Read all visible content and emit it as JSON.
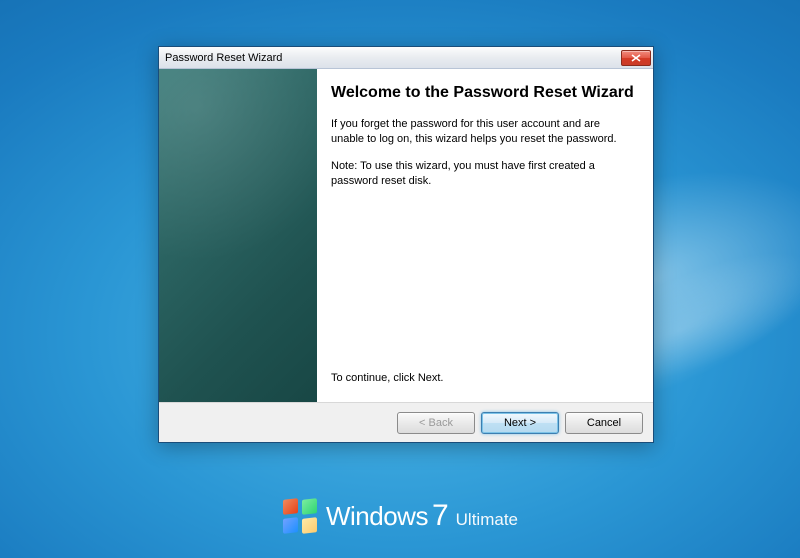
{
  "dialog": {
    "title": "Password Reset Wizard",
    "heading": "Welcome to the Password Reset Wizard",
    "paragraph1": "If you forget the password for this user account and are unable to log on, this wizard helps you reset the password.",
    "paragraph2": "Note: To use this wizard, you must have first created a password reset disk.",
    "continue_text": "To continue, click Next.",
    "buttons": {
      "back": "< Back",
      "next": "Next >",
      "cancel": "Cancel"
    }
  },
  "branding": {
    "product": "Windows",
    "version": "7",
    "edition": "Ultimate"
  }
}
